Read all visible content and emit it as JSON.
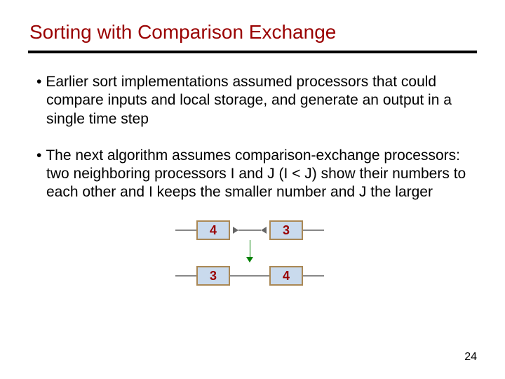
{
  "title": "Sorting with Comparison Exchange",
  "bullets": [
    "Earlier sort implementations assumed processors that could compare inputs and local storage, and generate an output in a single time step",
    "The next algorithm assumes comparison-exchange processors: two neighboring processors I and J (I < J) show their numbers to each other and I keeps the smaller number and J the larger"
  ],
  "diagram": {
    "top_left": "4",
    "top_right": "3",
    "bottom_left": "3",
    "bottom_right": "4"
  },
  "page_number": "24"
}
